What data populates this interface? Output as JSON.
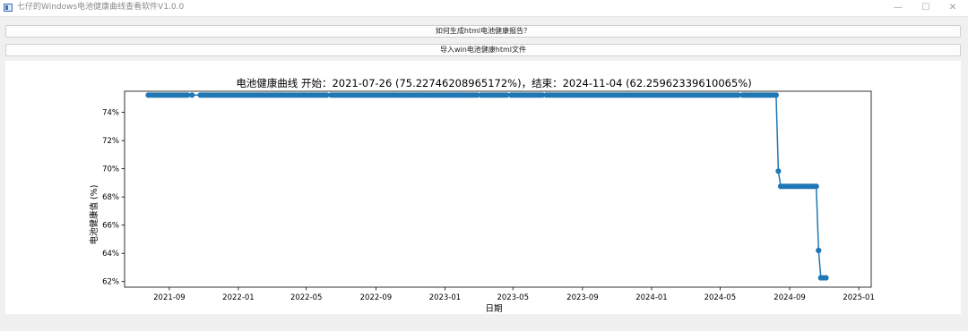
{
  "window": {
    "title": "七仔的Windows电池健康曲线查看软件V1.0.0",
    "minimize_glyph": "—",
    "maximize_glyph": "☐",
    "close_glyph": "✕"
  },
  "buttons": {
    "how_to_generate": "如何生成html电池健康报告？",
    "import_file": "导入win电池健康html文件"
  },
  "chart_data": {
    "type": "line",
    "title": "电池健康曲线 开始：2021-07-26 (75.22746208965172%)，结束：2024-11-04 (62.25962339610065%)",
    "xlabel": "日期",
    "ylabel": "电池健康值 (%)",
    "x_range": [
      "2021-06-14",
      "2025-01-23"
    ],
    "y_range": [
      61.6,
      75.5
    ],
    "x_ticks": [
      "2021-09",
      "2022-01",
      "2022-05",
      "2022-09",
      "2023-01",
      "2023-05",
      "2023-09",
      "2024-01",
      "2024-05",
      "2024-09",
      "2025-01"
    ],
    "y_ticks": [
      62,
      64,
      66,
      68,
      70,
      72,
      74
    ],
    "y_tick_format": "%",
    "grid": false,
    "line_color": "#1f77b4",
    "marker": "circle",
    "series": [
      {
        "segments": [
          {
            "start": "2021-07-26",
            "end": "2021-10-03",
            "value": 75.23
          },
          {
            "start": "2021-10-11",
            "end": "2021-10-11",
            "value": 75.23
          },
          {
            "start": "2021-10-26",
            "end": "2022-06-06",
            "value": 75.23
          },
          {
            "start": "2022-06-14",
            "end": "2023-02-27",
            "value": 75.23
          },
          {
            "start": "2023-03-06",
            "end": "2023-04-20",
            "value": 75.23
          },
          {
            "start": "2023-04-28",
            "end": "2023-06-22",
            "value": 75.23
          },
          {
            "start": "2023-06-29",
            "end": "2024-06-02",
            "value": 75.23
          },
          {
            "start": "2024-06-10",
            "end": "2024-08-08",
            "value": 75.23
          },
          {
            "start": "2024-08-12",
            "end": "2024-08-12",
            "value": 69.83
          },
          {
            "start": "2024-08-16",
            "end": "2024-10-18",
            "value": 68.75
          },
          {
            "start": "2024-10-22",
            "end": "2024-10-22",
            "value": 64.2
          },
          {
            "start": "2024-10-26",
            "end": "2024-11-04",
            "value": 62.26
          }
        ]
      }
    ]
  }
}
